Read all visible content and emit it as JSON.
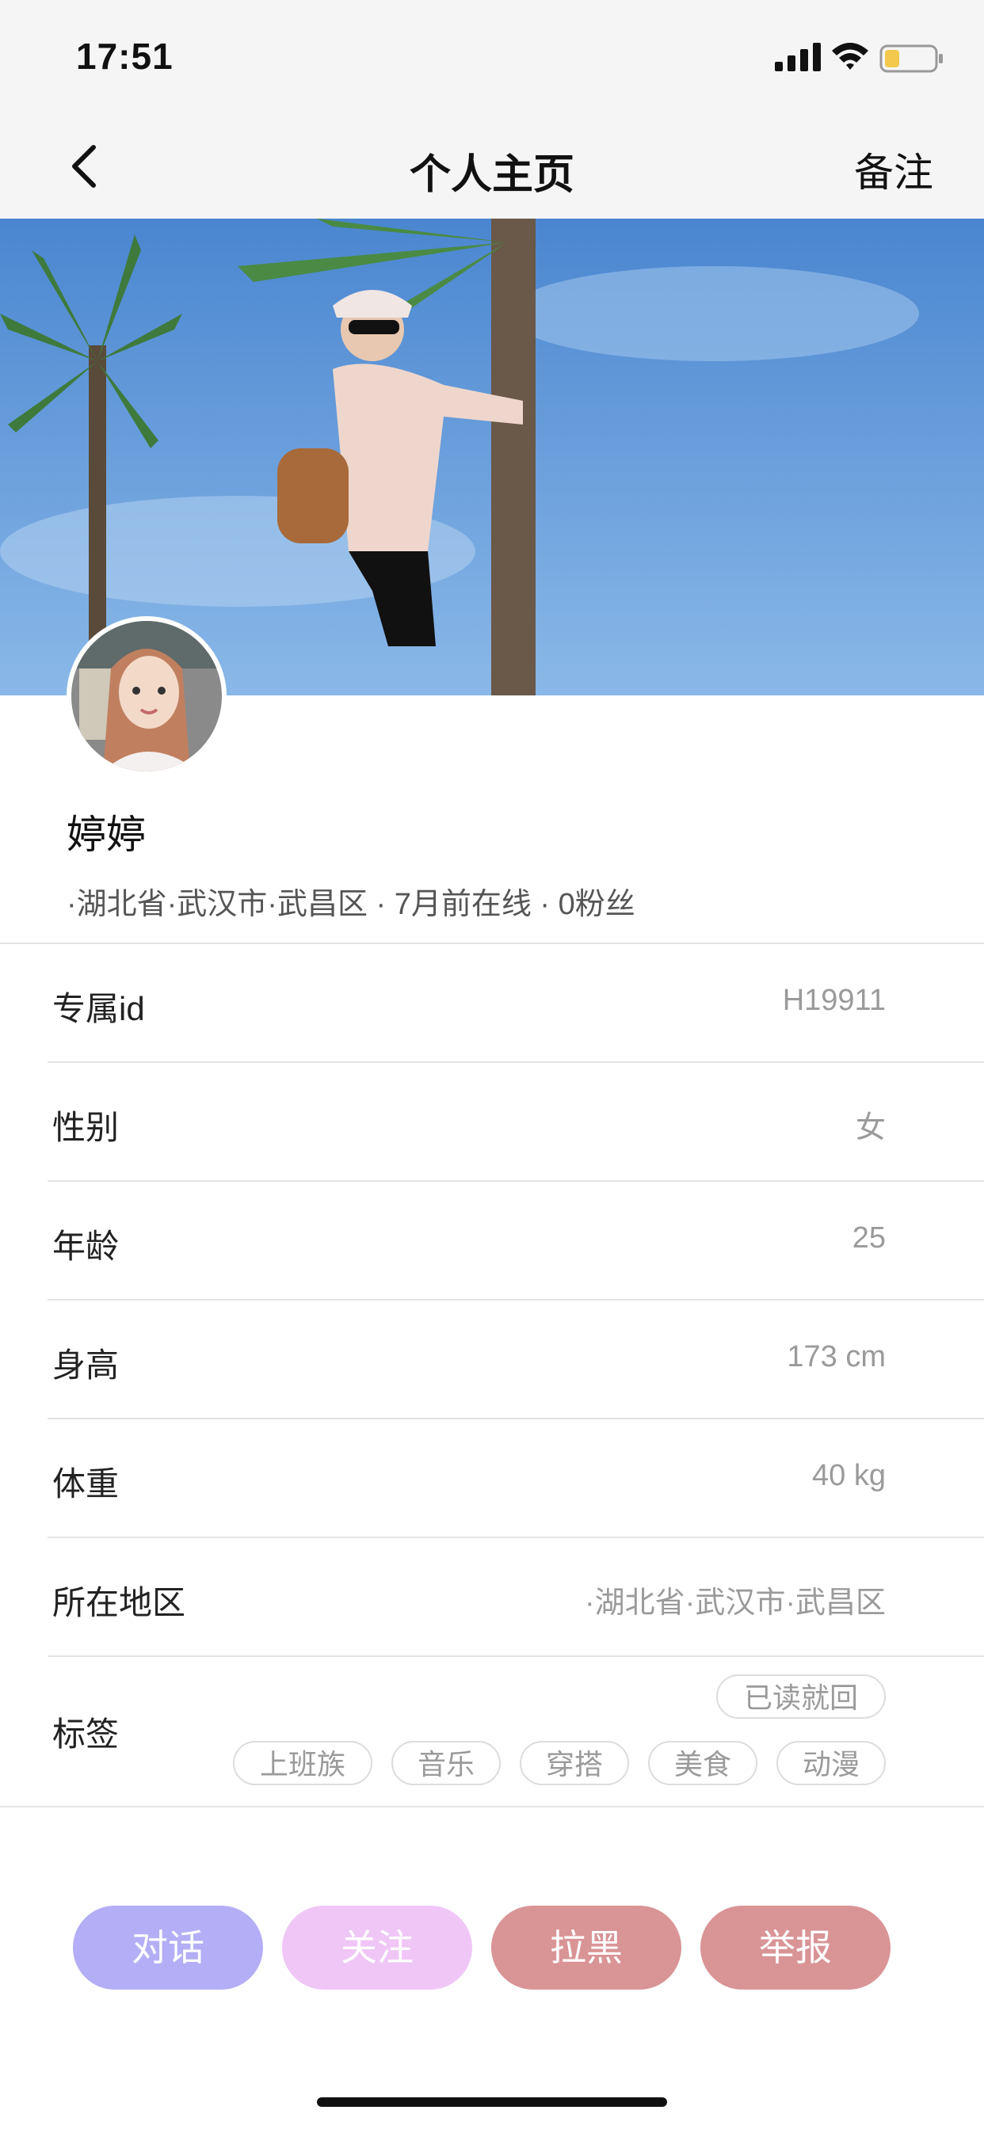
{
  "status_bar": {
    "time": "17:51"
  },
  "nav": {
    "title": "个人主页",
    "remark_label": "备注"
  },
  "profile": {
    "name": "婷婷",
    "meta": "·湖北省·武汉市·武昌区 · 7月前在线 · 0粉丝"
  },
  "info_rows": [
    {
      "label": "专属id",
      "value": "H19911"
    },
    {
      "label": "性别",
      "value": "女"
    },
    {
      "label": "年龄",
      "value": "25"
    },
    {
      "label": "身高",
      "value": "173 cm"
    },
    {
      "label": "体重",
      "value": "40 kg"
    },
    {
      "label": "所在地区",
      "value": "·湖北省·武汉市·武昌区"
    }
  ],
  "tags": {
    "label": "标签",
    "items": [
      "已读就回",
      "上班族",
      "音乐",
      "穿搭",
      "美食",
      "动漫"
    ]
  },
  "actions": [
    {
      "label": "对话",
      "color": "#b3aef5"
    },
    {
      "label": "关注",
      "color": "#f0c6f7"
    },
    {
      "label": "拉黑",
      "color": "#d99496"
    },
    {
      "label": "举报",
      "color": "#d99496"
    }
  ],
  "icons": [
    "back-arrow-icon",
    "signal-icon",
    "wifi-icon",
    "battery-icon"
  ]
}
